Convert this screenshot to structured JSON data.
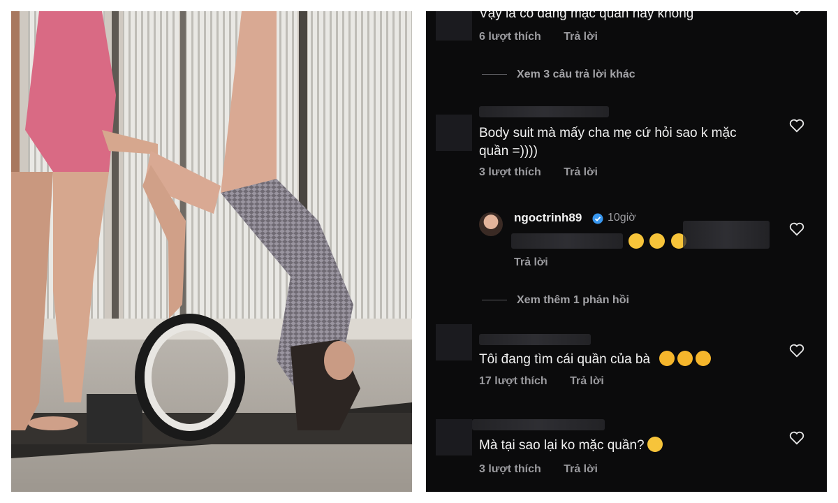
{
  "comments": [
    {
      "text": "Vậy là có đang mặc quần hay không",
      "likes": "6 lượt thích",
      "reply": "Trả lời"
    },
    {
      "more_replies": "Xem 3 câu trả lời khác"
    },
    {
      "text_line1": "Body suit mà mấy cha mẹ cứ hỏi sao k mặc",
      "text_line2": "quần =))))",
      "likes": "3 lượt thích",
      "reply": "Trả lời"
    },
    {
      "username": "ngoctrinh89",
      "time": "10giờ",
      "reply": "Trả lời",
      "emojis": [
        "rofl-emoji",
        "rofl-emoji",
        "rofl-emoji"
      ]
    },
    {
      "more_replies": "Xem thêm 1 phản hồi"
    },
    {
      "text": "Tôi đang tìm cái quần của bà",
      "likes": "17 lượt thích",
      "reply": "Trả lời",
      "emojis": [
        "heart-eyes-emoji",
        "heart-eyes-emoji",
        "heart-eyes-emoji"
      ]
    },
    {
      "text": "Mà tại sao lại ko mặc quần?",
      "likes": "3 lượt thích",
      "reply": "Trả lời",
      "emojis": [
        "astonished-emoji"
      ]
    }
  ],
  "colors": {
    "panel_bg": "#0b0b0c",
    "text": "#f1f1f1",
    "meta": "#9b9b9f",
    "verified": "#3897f0"
  }
}
